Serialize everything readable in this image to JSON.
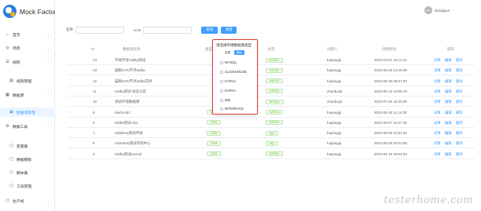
{
  "app": {
    "logo_text": "Mock Factory"
  },
  "header": {
    "user_initials": "shao",
    "user_name": "shaojiajun",
    "user_arrow": "⌄"
  },
  "sidebar": {
    "items": [
      {
        "label": "首页",
        "icon": "home-icon",
        "glyph": "⌂",
        "arrow": "⌄"
      },
      {
        "label": "场景",
        "icon": "scene-icon",
        "glyph": "◎",
        "arrow": "⌄"
      },
      {
        "label": "规则",
        "icon": "rule-icon",
        "glyph": "☰",
        "arrow": "⌃"
      },
      {
        "label": "规则管理",
        "icon": "rule-manage-icon",
        "glyph": "▤"
      },
      {
        "label": "数据源",
        "icon": "datasource-icon",
        "glyph": "▦",
        "arrow": "⌃"
      },
      {
        "label": "数据源管理",
        "icon": "datasource-manage-icon",
        "glyph": "▣"
      },
      {
        "label": "数据工具",
        "icon": "datatool-icon",
        "glyph": "⚙",
        "arrow": "⌃"
      },
      {
        "label": "变量集",
        "icon": "variable-icon",
        "glyph": "▢"
      },
      {
        "label": "数据模板",
        "icon": "template-icon",
        "glyph": "▢"
      },
      {
        "label": "脚本集",
        "icon": "script-icon",
        "glyph": "▢"
      },
      {
        "label": "工具管理",
        "icon": "tool-manage-icon",
        "glyph": "▢"
      },
      {
        "label": "生产线",
        "icon": "pipeline-icon",
        "glyph": "▢",
        "arrow": "⌄"
      }
    ]
  },
  "search": {
    "name_label": "名称",
    "host_label": "Host",
    "query_button": "查询",
    "add_button": "新增"
  },
  "table": {
    "headers": [
      "ID",
      "数据源名称",
      "类型",
      "标签",
      "创建人",
      "创建时间",
      "操作"
    ],
    "rows": [
      {
        "id": "14",
        "name": "开发环境-kafka测试",
        "type": "",
        "tag": "KAFKA",
        "creator": "fuqiangqi",
        "time": "2022-10-01 16:11:23"
      },
      {
        "id": "13",
        "name": "猫眼CHN节点kafka",
        "type": "",
        "tag": "KAFKA",
        "creator": "fuqiangqi",
        "time": "2022-05-25 14:40:08"
      },
      {
        "id": "12",
        "name": "猫眼CHN节点kafka实例",
        "type": "",
        "tag": "KAFKA",
        "creator": "fuqiangqi",
        "time": "2022-05-18 09:57:33"
      },
      {
        "id": "11",
        "name": "Kafka测试-动态分区",
        "type": "",
        "tag": "KAFKA",
        "creator": "zhaobojia",
        "time": "2022-05-13 10:55:19"
      },
      {
        "id": "10",
        "name": "测试环境数据库",
        "type": "",
        "tag": "MYSQL",
        "creator": "zhaobojia",
        "time": "2022-07-25 15:33:39"
      },
      {
        "id": "9",
        "name": "Mock-eb1",
        "type": "CRM",
        "tag": "KAFKA",
        "creator": "fuqiangqi",
        "time": "2022-05-15 11:14:30"
      },
      {
        "id": "8",
        "name": "Kafka测试-eb1",
        "type": "CRM",
        "tag": "KAFKA",
        "creator": "fuqiangqi",
        "time": "2022-05-07 12:27:26"
      },
      {
        "id": "7",
        "name": "rabbitmq测试环境",
        "type": "CRM",
        "tag": "MQ",
        "creator": "fuqiangqi",
        "time": "2022-05-09 12:51:04"
      },
      {
        "id": "6",
        "name": "rocketmq测试环境中心",
        "type": "CRM",
        "tag": "MQ",
        "creator": "fuqiangqi",
        "time": "2022-05-08 20:01:55"
      },
      {
        "id": "4",
        "name": "Kafka测试journal",
        "type": "CRM",
        "tag": "KAFKA",
        "creator": "fuqiangqi",
        "time": "2022-04-19 18:53:03"
      }
    ],
    "ops": {
      "view": "详情",
      "edit": "编辑",
      "delete": "删除"
    }
  },
  "popover": {
    "title": "请选择存储数据源类型",
    "reset": "重置",
    "confirm": "确认",
    "options": [
      "MYSQL",
      "CLICKHOUSE",
      "KAFKA",
      "KAFKA",
      "MQ",
      "INTERFACE"
    ]
  },
  "watermark": "testerhome.com",
  "colors": {
    "primary": "#409eff",
    "tag_green": "#67c23a",
    "popover_border": "#e53935"
  }
}
